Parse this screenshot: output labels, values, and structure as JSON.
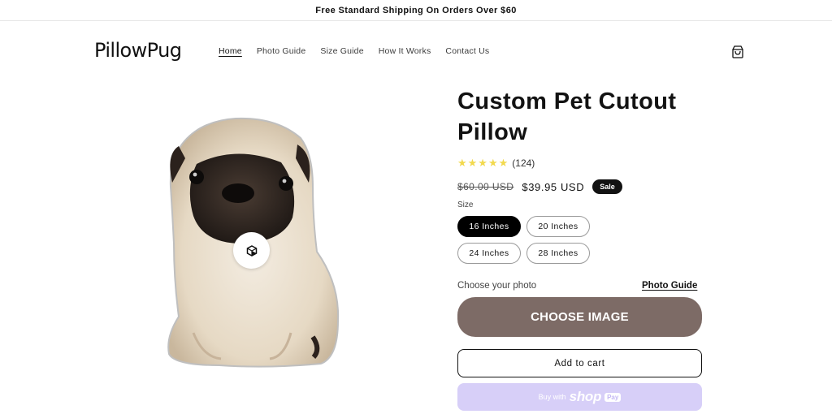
{
  "announcement": {
    "text": "Free Standard Shipping On Orders Over $60"
  },
  "header": {
    "logo": "PillowPug",
    "nav": [
      "Home",
      "Photo Guide",
      "Size Guide",
      "How It Works",
      "Contact Us"
    ],
    "active_nav": "Home",
    "cart_icon": "cart-icon"
  },
  "media": {
    "image": "pug-cutout-pillow",
    "view_icon": "3d-view-icon"
  },
  "product": {
    "title": "Custom Pet Cutout Pillow",
    "rating_count": "(124)",
    "stars": 5,
    "compare_price": "$60.00 USD",
    "price": "$39.95 USD",
    "badge": "Sale",
    "size_label": "Size",
    "sizes": [
      "16 Inches",
      "20 Inches",
      "24 Inches",
      "28 Inches"
    ],
    "selected_size": "16 Inches",
    "photo_label": "Choose your photo",
    "photo_guide_link": "Photo Guide",
    "choose_image": "CHOOSE IMAGE",
    "add_to_cart": "Add to cart",
    "buy_with": "Buy with",
    "shop_brand": "shop",
    "shop_pay": "Pay"
  },
  "colors": {
    "choose_button": "#7d6b66",
    "shop_pay_button": "#d7cff8",
    "stars": "#f2d94e",
    "badge": "#121212"
  }
}
